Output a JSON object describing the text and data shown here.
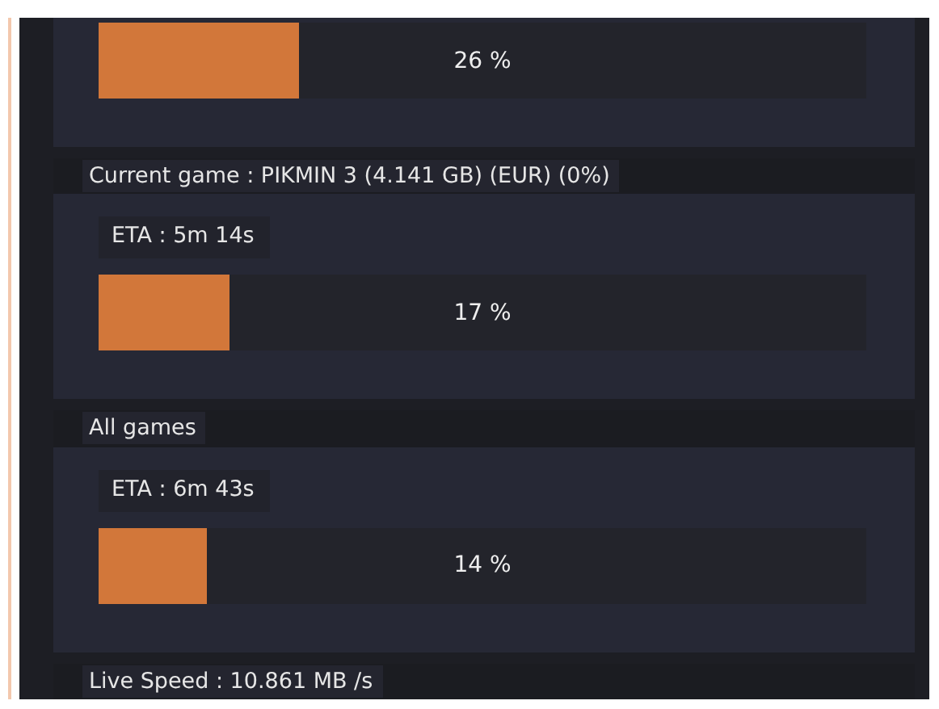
{
  "sections": [
    {
      "bar": {
        "level": 0.26,
        "reading": "26 %"
      }
    },
    {
      "title": "Current game : PIKMIN 3 (4.141 GB) (EUR) (0%)",
      "eta": "ETA : 5m 14s",
      "bar": {
        "level": 0.17,
        "reading": "17 %"
      }
    },
    {
      "title": "All games",
      "eta": "ETA : 6m 43s",
      "bar": {
        "level": 0.14,
        "reading": "14 %"
      }
    },
    {
      "title": "Live Speed : 10.861 MB /s"
    }
  ]
}
